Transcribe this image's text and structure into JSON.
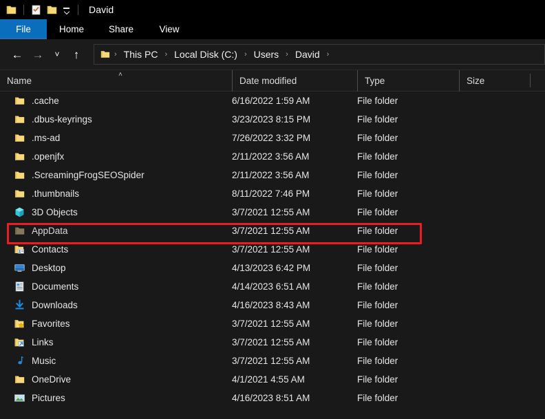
{
  "window": {
    "title": "David",
    "quick_access": [
      {
        "name": "folder-icon",
        "label": "Folder"
      },
      {
        "name": "properties-icon",
        "label": "Properties"
      },
      {
        "name": "new-folder-icon",
        "label": "New folder"
      },
      {
        "name": "chevron-down-icon",
        "label": "Customize Quick Access Toolbar"
      }
    ]
  },
  "ribbon": {
    "tabs": [
      {
        "label": "File",
        "active": true
      },
      {
        "label": "Home",
        "active": false
      },
      {
        "label": "Share",
        "active": false
      },
      {
        "label": "View",
        "active": false
      }
    ],
    "accent": "#0b6ebd"
  },
  "nav": {
    "back": "←",
    "forward": "→",
    "recent": "˅",
    "up": "↑",
    "breadcrumb": [
      "This PC",
      "Local Disk (C:)",
      "Users",
      "David"
    ],
    "separator": "›"
  },
  "columns": [
    {
      "label": "Name",
      "sorted": true,
      "sort_glyph": "˄"
    },
    {
      "label": "Date modified",
      "sorted": false,
      "sort_glyph": ""
    },
    {
      "label": "Type",
      "sorted": false,
      "sort_glyph": ""
    },
    {
      "label": "Size",
      "sorted": false,
      "sort_glyph": ""
    }
  ],
  "files": [
    {
      "name": ".cache",
      "date": "6/16/2022 1:59 AM",
      "type": "File folder",
      "size": "",
      "icon": "folder-icon",
      "highlighted": false
    },
    {
      "name": ".dbus-keyrings",
      "date": "3/23/2023 8:15 PM",
      "type": "File folder",
      "size": "",
      "icon": "folder-icon",
      "highlighted": false
    },
    {
      "name": ".ms-ad",
      "date": "7/26/2022 3:32 PM",
      "type": "File folder",
      "size": "",
      "icon": "folder-icon",
      "highlighted": false
    },
    {
      "name": ".openjfx",
      "date": "2/11/2022 3:56 AM",
      "type": "File folder",
      "size": "",
      "icon": "folder-icon",
      "highlighted": false
    },
    {
      "name": ".ScreamingFrogSEOSpider",
      "date": "2/11/2022 3:56 AM",
      "type": "File folder",
      "size": "",
      "icon": "folder-icon",
      "highlighted": false
    },
    {
      "name": ".thumbnails",
      "date": "8/11/2022 7:46 PM",
      "type": "File folder",
      "size": "",
      "icon": "folder-icon",
      "highlighted": false
    },
    {
      "name": "3D Objects",
      "date": "3/7/2021 12:55 AM",
      "type": "File folder",
      "size": "",
      "icon": "3d-objects-icon",
      "highlighted": false
    },
    {
      "name": "AppData",
      "date": "3/7/2021 12:55 AM",
      "type": "File folder",
      "size": "",
      "icon": "hidden-folder-icon",
      "highlighted": true
    },
    {
      "name": "Contacts",
      "date": "3/7/2021 12:55 AM",
      "type": "File folder",
      "size": "",
      "icon": "contacts-folder-icon",
      "highlighted": false
    },
    {
      "name": "Desktop",
      "date": "4/13/2023 6:42 PM",
      "type": "File folder",
      "size": "",
      "icon": "desktop-icon",
      "highlighted": false
    },
    {
      "name": "Documents",
      "date": "4/14/2023 6:51 AM",
      "type": "File folder",
      "size": "",
      "icon": "documents-icon",
      "highlighted": false
    },
    {
      "name": "Downloads",
      "date": "4/16/2023 8:43 AM",
      "type": "File folder",
      "size": "",
      "icon": "downloads-icon",
      "highlighted": false
    },
    {
      "name": "Favorites",
      "date": "3/7/2021 12:55 AM",
      "type": "File folder",
      "size": "",
      "icon": "favorites-folder-icon",
      "highlighted": false
    },
    {
      "name": "Links",
      "date": "3/7/2021 12:55 AM",
      "type": "File folder",
      "size": "",
      "icon": "links-folder-icon",
      "highlighted": false
    },
    {
      "name": "Music",
      "date": "3/7/2021 12:55 AM",
      "type": "File folder",
      "size": "",
      "icon": "music-icon",
      "highlighted": false
    },
    {
      "name": "OneDrive",
      "date": "4/1/2021 4:55 AM",
      "type": "File folder",
      "size": "",
      "icon": "folder-icon",
      "highlighted": false
    },
    {
      "name": "Pictures",
      "date": "4/16/2023 8:51 AM",
      "type": "File folder",
      "size": "",
      "icon": "pictures-icon",
      "highlighted": false
    }
  ],
  "annotation": {
    "color": "#ee1b24",
    "target": "AppData"
  }
}
